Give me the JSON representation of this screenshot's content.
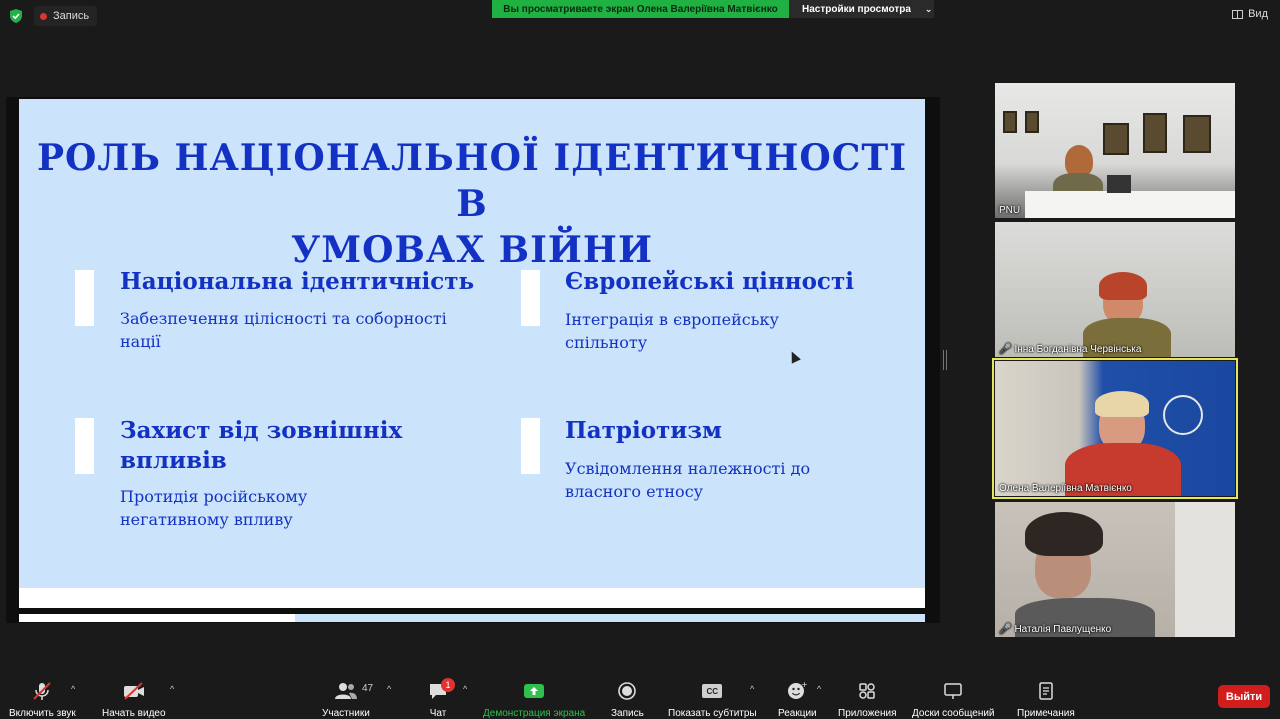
{
  "topbar": {
    "record_label": "Запись",
    "share_banner": "Вы просматриваете экран Олена Валеріївна Матвієнко",
    "view_settings_label": "Настройки просмотра",
    "view_label": "Вид",
    "record_color": "#e0322e",
    "banner_color": "#1fb141"
  },
  "slide": {
    "title_line1": "РОЛЬ НАЦІОНАЛЬНОЇ ІДЕНТИЧНОСТІ В",
    "title_line2": "УМОВАХ ВІЙНИ",
    "items": [
      {
        "title": "Національна ідентичність",
        "desc_line1": "Забезпечення цілісності та соборності",
        "desc_line2": "нації"
      },
      {
        "title": "Європейські цінності",
        "desc_line1": "Інтеграція в європейську",
        "desc_line2": "спільноту"
      },
      {
        "title_line1": "Захист від зовнішніх",
        "title_line2": "впливів",
        "desc_line1": "Протидія російському",
        "desc_line2": "негативному впливу"
      },
      {
        "title": "Патріотизм",
        "desc_line1": "Усвідомлення належності до",
        "desc_line2": "власного етносу"
      }
    ],
    "background_color": "#cbe4fb",
    "text_color": "#1332c4"
  },
  "participants": [
    {
      "name": "PNU",
      "muted": false
    },
    {
      "name": "Інна Богданівна Червінська",
      "muted": true
    },
    {
      "name": "Олена Валеріївна Матвієнко",
      "muted": false,
      "active_speaker": true
    },
    {
      "name": "Наталія Павлущенко",
      "muted": true
    }
  ],
  "toolbar": {
    "audio_label": "Включить звук",
    "video_label": "Начать видео",
    "participants_label": "Участники",
    "participants_count": "47",
    "chat_label": "Чат",
    "chat_badge": "1",
    "share_label": "Демонстрация экрана",
    "record_label": "Запись",
    "captions_label": "Показать субтитры",
    "captions_icon_text": "CC",
    "reactions_label": "Реакции",
    "apps_label": "Приложения",
    "whiteboards_label": "Доски сообщений",
    "notes_label": "Примечания",
    "exit_label": "Выйти",
    "exit_color": "#d21d1d"
  }
}
